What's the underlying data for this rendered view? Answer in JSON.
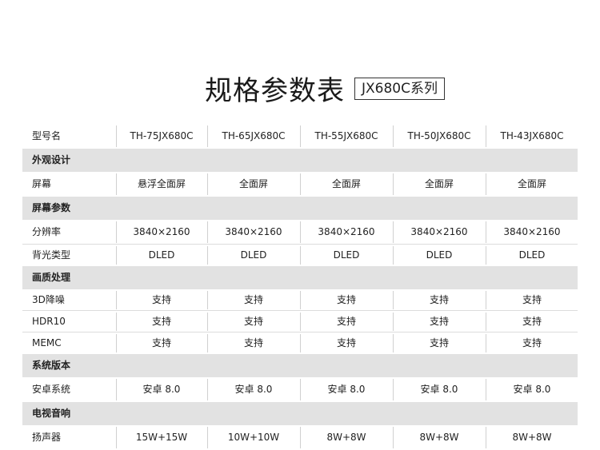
{
  "title": "规格参数表",
  "series_label": "JX680C系列",
  "models": {
    "label": "型号名",
    "values": [
      "TH-75JX680C",
      "TH-65JX680C",
      "TH-55JX680C",
      "TH-50JX680C",
      "TH-43JX680C"
    ]
  },
  "sections": {
    "design": {
      "title": "外观设计",
      "screen": {
        "label": "屏幕",
        "values": [
          "悬浮全面屏",
          "全面屏",
          "全面屏",
          "全面屏",
          "全面屏"
        ]
      }
    },
    "screen_params": {
      "title": "屏幕参数",
      "resolution": {
        "label": "分辨率",
        "values": [
          "3840×2160",
          "3840×2160",
          "3840×2160",
          "3840×2160",
          "3840×2160"
        ]
      },
      "backlight": {
        "label": "背光类型",
        "values": [
          "DLED",
          "DLED",
          "DLED",
          "DLED",
          "DLED"
        ]
      }
    },
    "picture": {
      "title": "画质处理",
      "dnr": {
        "label": "3D降噪",
        "values": [
          "支持",
          "支持",
          "支持",
          "支持",
          "支持"
        ]
      },
      "hdr": {
        "label": "HDR10",
        "values": [
          "支持",
          "支持",
          "支持",
          "支持",
          "支持"
        ]
      },
      "memc": {
        "label": "MEMC",
        "values": [
          "支持",
          "支持",
          "支持",
          "支持",
          "支持"
        ]
      }
    },
    "system": {
      "title": "系统版本",
      "os": {
        "label": "安卓系统",
        "values": [
          "安卓 8.0",
          "安卓 8.0",
          "安卓 8.0",
          "安卓 8.0",
          "安卓 8.0"
        ]
      }
    },
    "audio": {
      "title": "电视音响",
      "speaker": {
        "label": "扬声器",
        "values": [
          "15W+15W",
          "10W+10W",
          "8W+8W",
          "8W+8W",
          "8W+8W"
        ]
      }
    }
  }
}
